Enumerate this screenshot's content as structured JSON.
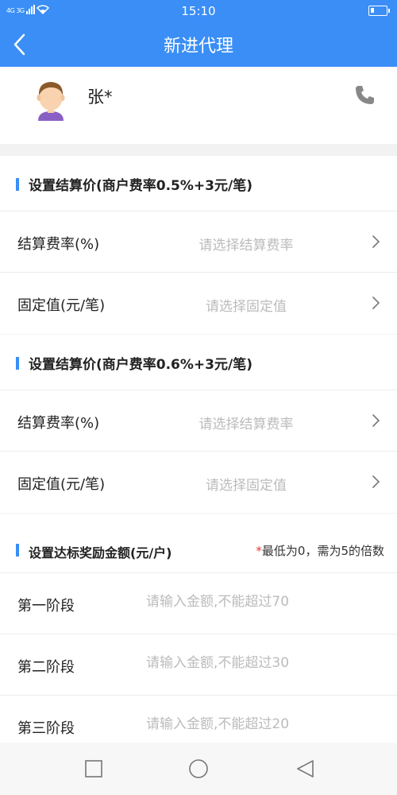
{
  "status_bar": {
    "network": "4G 3G",
    "time": "15:10",
    "icons": [
      "signal-icon",
      "wifi-icon",
      "battery-icon"
    ]
  },
  "nav": {
    "title": "新进代理",
    "back_icon": "chevron-left-icon"
  },
  "profile": {
    "name": "张*",
    "avatar_icon": "avatar-icon",
    "phone_icon": "phone-icon"
  },
  "sections": [
    {
      "title": "设置结算价(商户费率0.5%+3元/笔)",
      "rows": [
        {
          "label": "结算费率(%)",
          "placeholder": "请选择结算费率"
        },
        {
          "label": "固定值(元/笔)",
          "placeholder": "请选择固定值"
        }
      ]
    },
    {
      "title": "设置结算价(商户费率0.6%+3元/笔)",
      "rows": [
        {
          "label": "结算费率(%)",
          "placeholder": "请选择结算费率"
        },
        {
          "label": "固定值(元/笔)",
          "placeholder": "请选择固定值"
        }
      ]
    },
    {
      "title": "设置达标奖励金额(元/户)",
      "note_star": "*",
      "note": "最低为0，需为5的倍数",
      "rows": [
        {
          "label": "第一阶段",
          "placeholder": "请输入金额,不能超过70"
        },
        {
          "label": "第二阶段",
          "placeholder": "请输入金额,不能超过30"
        },
        {
          "label": "第三阶段",
          "placeholder": "请输入金额,不能超过20"
        }
      ]
    }
  ],
  "colors": {
    "primary": "#3a8ef6",
    "background": "#f2f2f2",
    "placeholder": "#bbbbbb",
    "required_star": "#e53935"
  },
  "system_nav": [
    "recent-apps-icon",
    "home-icon",
    "back-icon"
  ]
}
